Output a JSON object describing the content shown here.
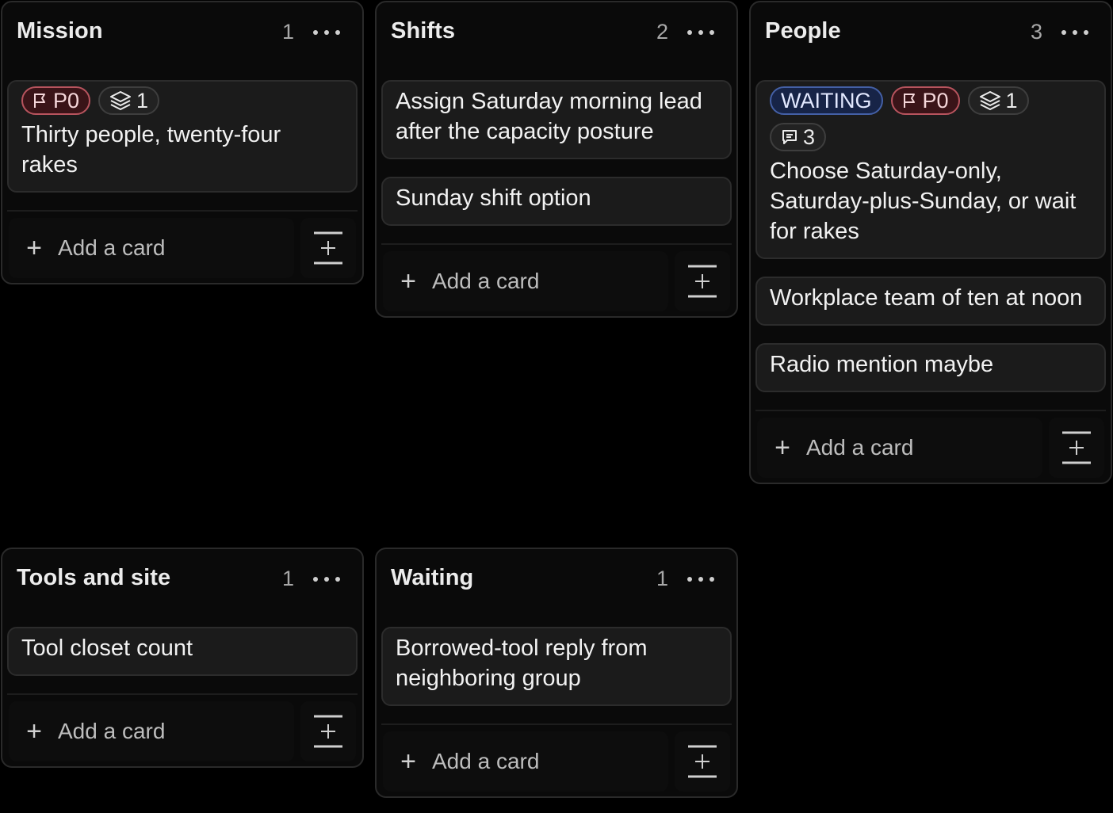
{
  "columns": [
    {
      "title": "Mission",
      "count": "1",
      "cards": [
        {
          "title": "Thirty people, twenty-four rakes",
          "badges": [
            {
              "type": "priority",
              "icon": "flag-icon",
              "label": "P0"
            },
            {
              "type": "neutral",
              "icon": "layers-icon",
              "label": "1"
            }
          ]
        }
      ],
      "add_label": "Add a card"
    },
    {
      "title": "Shifts",
      "count": "2",
      "cards": [
        {
          "title": "Assign Saturday morning lead after the capacity posture",
          "badges": []
        },
        {
          "title": "Sunday shift option",
          "badges": []
        }
      ],
      "add_label": "Add a card"
    },
    {
      "title": "People",
      "count": "3",
      "cards": [
        {
          "title": "Choose Saturday-only, Saturday-plus-Sunday, or wait for rakes",
          "badges": [
            {
              "type": "waiting",
              "icon": "",
              "label": "WAITING"
            },
            {
              "type": "priority",
              "icon": "flag-icon",
              "label": "P0"
            },
            {
              "type": "neutral",
              "icon": "layers-icon",
              "label": "1"
            },
            {
              "type": "neutral",
              "icon": "comment-icon",
              "label": "3"
            }
          ]
        },
        {
          "title": "Workplace team of ten at noon",
          "badges": []
        },
        {
          "title": "Radio mention maybe",
          "badges": []
        }
      ],
      "add_label": "Add a card"
    },
    {
      "title": "Tools and site",
      "count": "1",
      "cards": [
        {
          "title": "Tool closet count",
          "badges": []
        }
      ],
      "add_label": "Add a card"
    },
    {
      "title": "Waiting",
      "count": "1",
      "cards": [
        {
          "title": "Borrowed-tool reply from neighboring group",
          "badges": []
        }
      ],
      "add_label": "Add a card"
    }
  ]
}
